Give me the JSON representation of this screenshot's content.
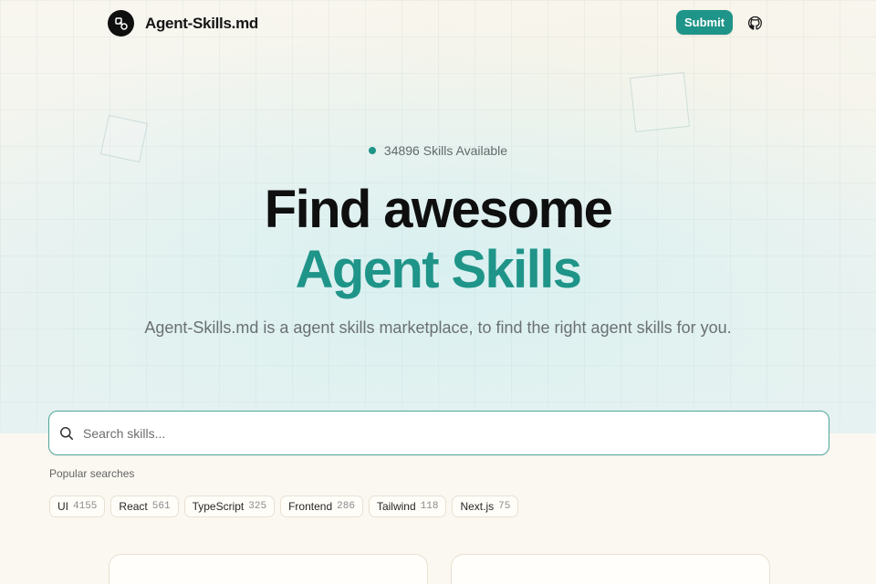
{
  "header": {
    "logo_text": "Agent-Skills.md",
    "logo_icon": "link-shapes-icon",
    "submit_label": "Submit",
    "github_icon": "github-icon"
  },
  "hero": {
    "availability": "34896 Skills Available",
    "headline_line1": "Find awesome",
    "headline_line2": "Agent Skills",
    "subtitle": "Agent-Skills.md is a agent skills marketplace, to find the right agent skills for you."
  },
  "search": {
    "placeholder": "Search skills...",
    "icon": "search-icon"
  },
  "popular": {
    "label": "Popular searches",
    "tags": [
      {
        "name": "UI",
        "count": "4155"
      },
      {
        "name": "React",
        "count": "561"
      },
      {
        "name": "TypeScript",
        "count": "325"
      },
      {
        "name": "Frontend",
        "count": "286"
      },
      {
        "name": "Tailwind",
        "count": "118"
      },
      {
        "name": "Next.js",
        "count": "75"
      }
    ]
  },
  "colors": {
    "accent": "#1f9488",
    "background": "#fbf8f1",
    "text": "#111111"
  }
}
